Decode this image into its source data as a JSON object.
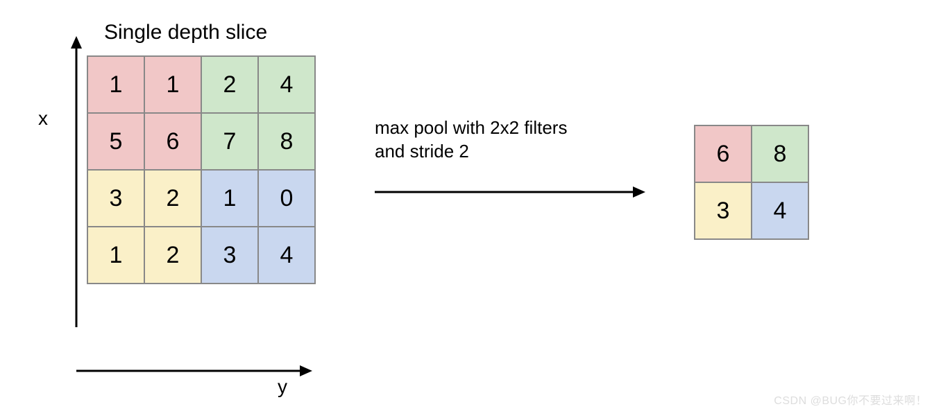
{
  "title": "Single depth slice",
  "axis": {
    "x": "x",
    "y": "y"
  },
  "operation": "max pool with 2x2 filters\nand stride 2",
  "colors": {
    "pink": "#f1c7c7",
    "green": "#cfe7cb",
    "yellow": "#faf0c8",
    "blue": "#c9d7ef"
  },
  "input_grid": {
    "rows": 4,
    "cols": 4,
    "cells": [
      {
        "v": "1",
        "c": "pink"
      },
      {
        "v": "1",
        "c": "pink"
      },
      {
        "v": "2",
        "c": "green"
      },
      {
        "v": "4",
        "c": "green"
      },
      {
        "v": "5",
        "c": "pink"
      },
      {
        "v": "6",
        "c": "pink"
      },
      {
        "v": "7",
        "c": "green"
      },
      {
        "v": "8",
        "c": "green"
      },
      {
        "v": "3",
        "c": "yellow"
      },
      {
        "v": "2",
        "c": "yellow"
      },
      {
        "v": "1",
        "c": "blue"
      },
      {
        "v": "0",
        "c": "blue"
      },
      {
        "v": "1",
        "c": "yellow"
      },
      {
        "v": "2",
        "c": "yellow"
      },
      {
        "v": "3",
        "c": "blue"
      },
      {
        "v": "4",
        "c": "blue"
      }
    ]
  },
  "output_grid": {
    "rows": 2,
    "cols": 2,
    "cells": [
      {
        "v": "6",
        "c": "pink"
      },
      {
        "v": "8",
        "c": "green"
      },
      {
        "v": "3",
        "c": "yellow"
      },
      {
        "v": "4",
        "c": "blue"
      }
    ]
  },
  "watermark": "CSDN @BUG你不要过来啊！",
  "chart_data": {
    "type": "table",
    "description": "Max pooling 2x2 stride 2 on a 4x4 single-depth slice producing a 2x2 output",
    "input": [
      [
        1,
        1,
        2,
        4
      ],
      [
        5,
        6,
        7,
        8
      ],
      [
        3,
        2,
        1,
        0
      ],
      [
        1,
        2,
        3,
        4
      ]
    ],
    "output": [
      [
        6,
        8
      ],
      [
        3,
        4
      ]
    ],
    "filter_size": "2x2",
    "stride": 2,
    "region_colors": {
      "top_left": "pink",
      "top_right": "green",
      "bottom_left": "yellow",
      "bottom_right": "blue"
    }
  }
}
